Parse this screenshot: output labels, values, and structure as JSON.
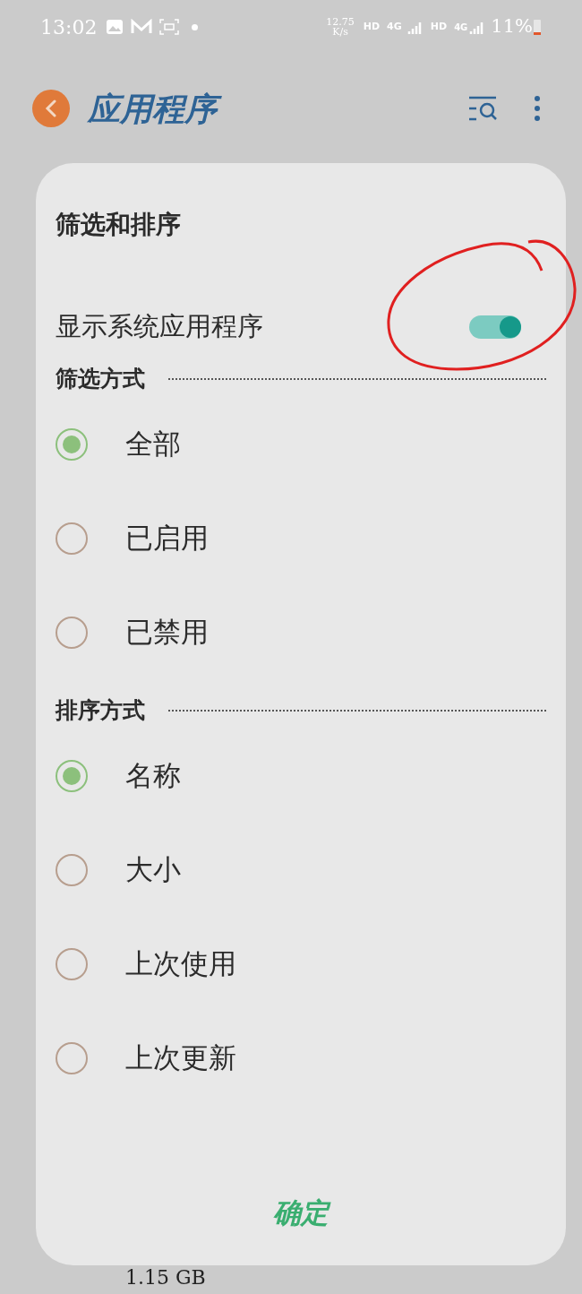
{
  "status_bar": {
    "time": "13:02",
    "net_speed": [
      "12.75",
      "K/s"
    ],
    "hd_1": "HD",
    "net_1": "4G",
    "hd_2": "HD",
    "net_2": "4G",
    "battery": "11%"
  },
  "header": {
    "title": "应用程序"
  },
  "dialog": {
    "title": "筛选和排序",
    "toggle": {
      "label": "显示系统应用程序",
      "on": true
    },
    "sections": [
      {
        "title": "筛选方式",
        "options": [
          {
            "label": "全部",
            "selected": true
          },
          {
            "label": "已启用",
            "selected": false
          },
          {
            "label": "已禁用",
            "selected": false
          }
        ]
      },
      {
        "title": "排序方式",
        "options": [
          {
            "label": "名称",
            "selected": true
          },
          {
            "label": "大小",
            "selected": false
          },
          {
            "label": "上次使用",
            "selected": false
          },
          {
            "label": "上次更新",
            "selected": false
          }
        ]
      }
    ],
    "confirm": "确定"
  },
  "behind": {
    "size": "1.15 GB"
  }
}
